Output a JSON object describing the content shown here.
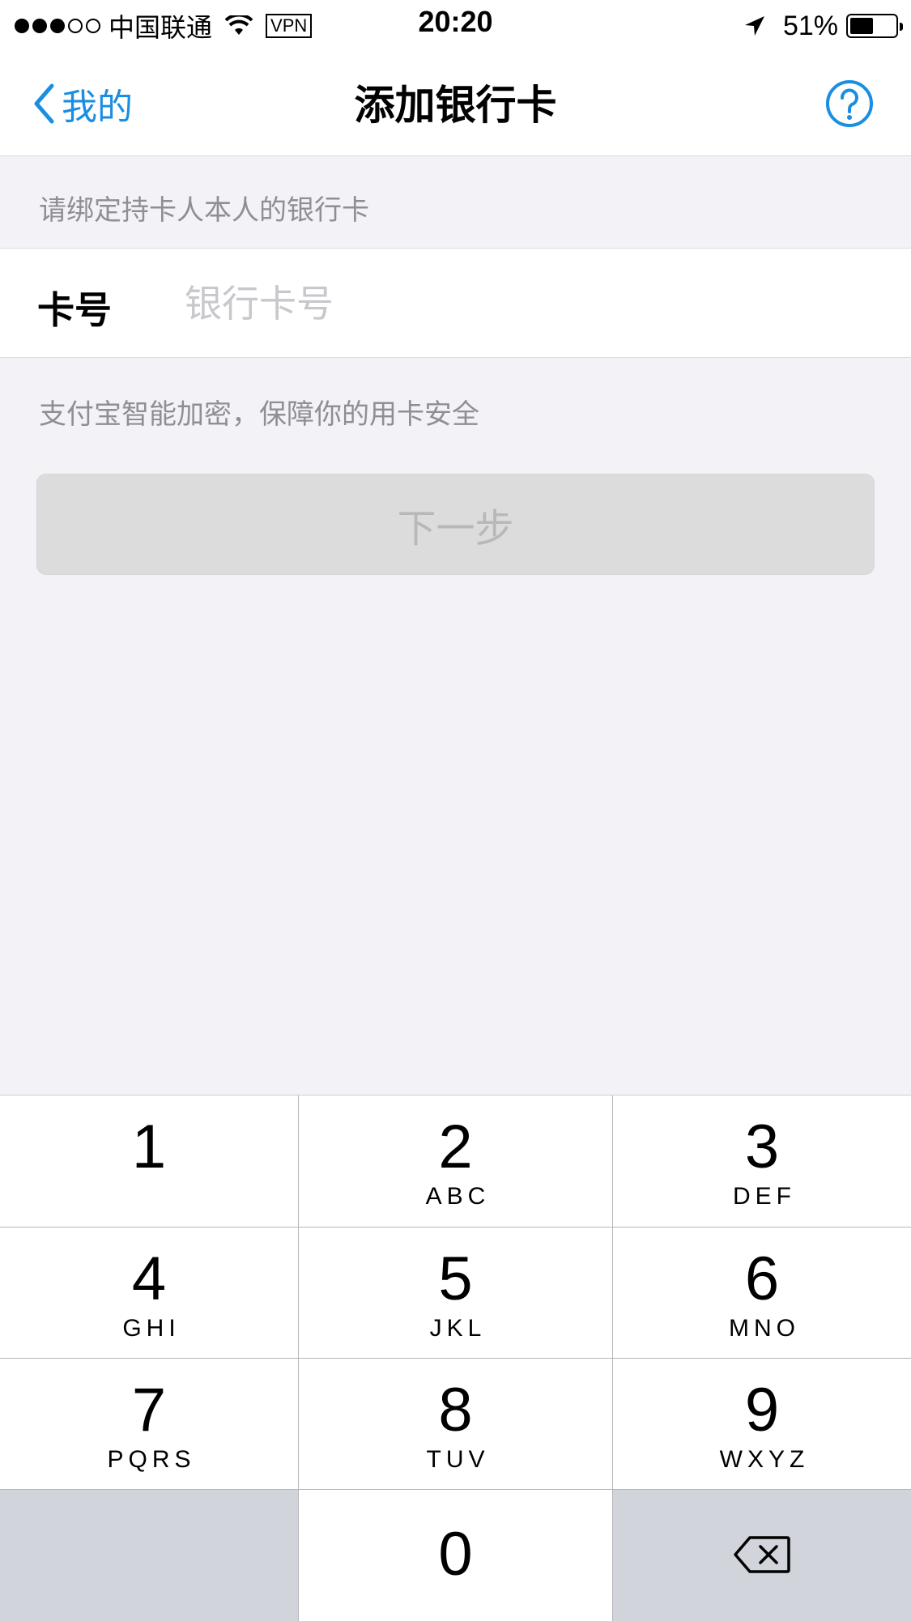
{
  "status_bar": {
    "signal": {
      "filled": 3,
      "total": 5
    },
    "carrier": "中国联通",
    "vpn": "VPN",
    "time": "20:20",
    "battery_text": "51%",
    "battery_level": 0.51,
    "icons": [
      "signal-dots-icon",
      "wifi-icon",
      "location-arrow-icon",
      "battery-icon"
    ]
  },
  "nav": {
    "back_label": "我的",
    "title": "添加银行卡",
    "help_icon": "question-circle-icon",
    "accent_color": "#1a8ee1"
  },
  "form": {
    "instruction": "请绑定持卡人本人的银行卡",
    "card_label": "卡号",
    "card_placeholder": "银行卡号",
    "card_value": "",
    "security_note": "支付宝智能加密，保障你的用卡安全",
    "next_label": "下一步"
  },
  "keypad": {
    "keys": [
      {
        "num": "1",
        "letters": ""
      },
      {
        "num": "2",
        "letters": "ABC"
      },
      {
        "num": "3",
        "letters": "DEF"
      },
      {
        "num": "4",
        "letters": "GHI"
      },
      {
        "num": "5",
        "letters": "JKL"
      },
      {
        "num": "6",
        "letters": "MNO"
      },
      {
        "num": "7",
        "letters": "PQRS"
      },
      {
        "num": "8",
        "letters": "TUV"
      },
      {
        "num": "9",
        "letters": "WXYZ"
      },
      {
        "num": "0",
        "letters": ""
      }
    ],
    "delete_icon": "backspace-icon"
  }
}
